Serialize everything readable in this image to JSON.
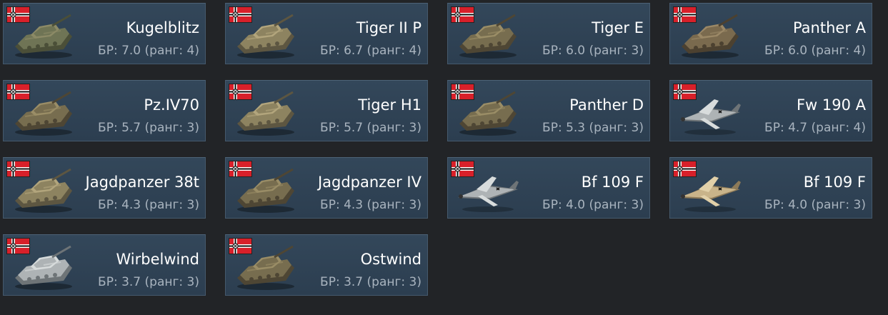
{
  "nation": {
    "flag_icon": "germany-flag-icon"
  },
  "vehicles": [
    {
      "name": "Kugelblitz",
      "br": "БР: 7.0 (ранг: 4)",
      "kind": "tank",
      "camo": "green"
    },
    {
      "name": "Tiger II P",
      "br": "БР: 6.7 (ранг: 4)",
      "kind": "tank",
      "camo": "sand"
    },
    {
      "name": "Tiger E",
      "br": "БР: 6.0 (ранг: 3)",
      "kind": "tank",
      "camo": "olive"
    },
    {
      "name": "Panther A",
      "br": "БР: 6.0 (ранг: 4)",
      "kind": "tank",
      "camo": "brown"
    },
    {
      "name": "Pz.IV70",
      "br": "БР: 5.7 (ранг: 3)",
      "kind": "tank",
      "camo": "olive"
    },
    {
      "name": "Tiger H1",
      "br": "БР: 5.7 (ранг: 3)",
      "kind": "tank",
      "camo": "sand"
    },
    {
      "name": "Panther D",
      "br": "БР: 5.3 (ранг: 3)",
      "kind": "tank",
      "camo": "olive"
    },
    {
      "name": "Fw 190 A",
      "br": "БР: 4.7 (ранг: 4)",
      "kind": "plane",
      "camo": "grey"
    },
    {
      "name": "Jagdpanzer 38t",
      "br": "БР: 4.3 (ранг: 3)",
      "kind": "tank",
      "camo": "sand"
    },
    {
      "name": "Jagdpanzer IV",
      "br": "БР: 4.3 (ранг: 3)",
      "kind": "tank",
      "camo": "olive"
    },
    {
      "name": "Bf 109 F",
      "br": "БР: 4.0 (ранг: 3)",
      "kind": "plane",
      "camo": "grey"
    },
    {
      "name": "Bf 109 F",
      "br": "БР: 4.0 (ранг: 3)",
      "kind": "plane",
      "camo": "tan"
    },
    {
      "name": "Wirbelwind",
      "br": "БР: 3.7 (ранг: 3)",
      "kind": "tank",
      "camo": "grey"
    },
    {
      "name": "Ostwind",
      "br": "БР: 3.7 (ранг: 3)",
      "kind": "tank",
      "camo": "olive"
    }
  ],
  "colors": {
    "background": "#222427",
    "card": "#2f4254",
    "name": "#ffffff",
    "br": "#a9b4bf"
  }
}
